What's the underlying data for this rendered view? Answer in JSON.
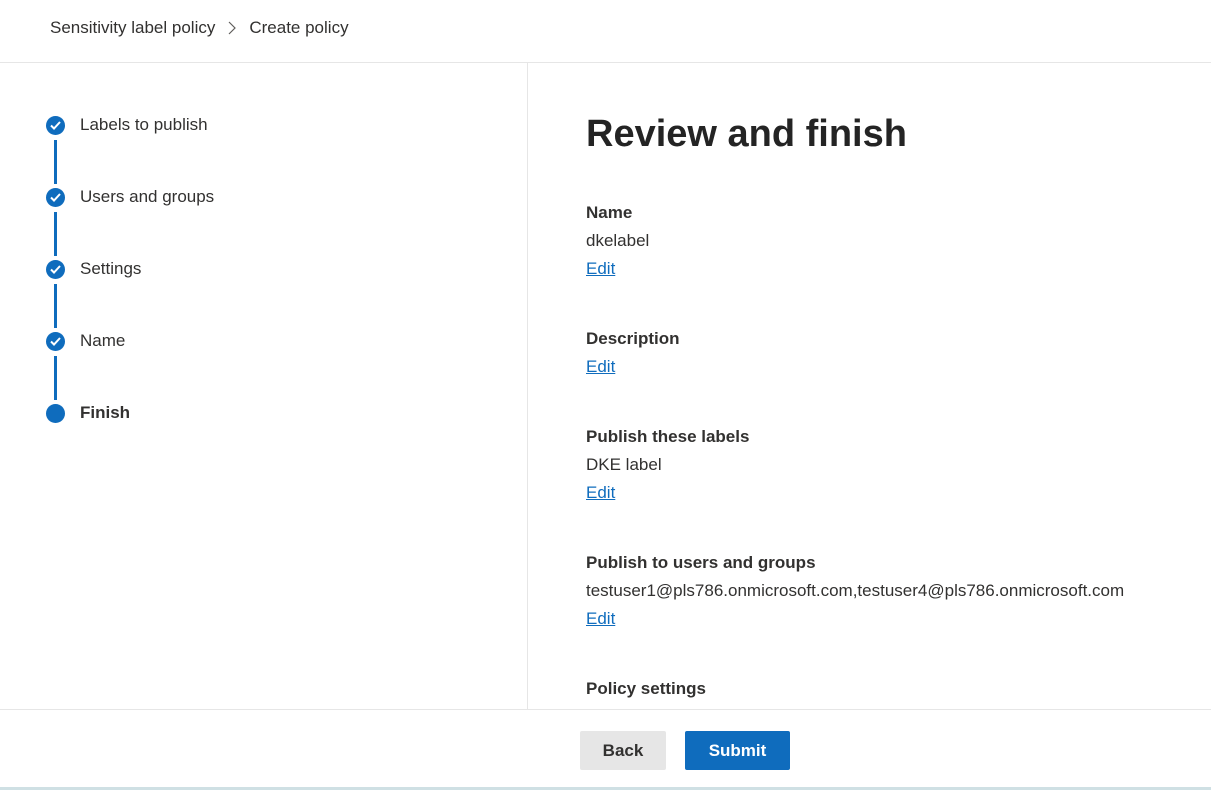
{
  "breadcrumb": {
    "parent": "Sensitivity label policy",
    "current": "Create policy"
  },
  "steps": [
    {
      "label": "Labels to publish",
      "status": "completed"
    },
    {
      "label": "Users and groups",
      "status": "completed"
    },
    {
      "label": "Settings",
      "status": "completed"
    },
    {
      "label": "Name",
      "status": "completed"
    },
    {
      "label": "Finish",
      "status": "current"
    }
  ],
  "main": {
    "title": "Review and finish",
    "sections": [
      {
        "title": "Name",
        "value": "dkelabel",
        "edit": "Edit"
      },
      {
        "title": "Description",
        "value": "",
        "edit": "Edit"
      },
      {
        "title": "Publish these labels",
        "value": "DKE label",
        "edit": "Edit"
      },
      {
        "title": "Publish to users and groups",
        "value": "testuser1@pls786.onmicrosoft.com,testuser4@pls786.onmicrosoft.com",
        "edit": "Edit"
      },
      {
        "title": "Policy settings",
        "value": "",
        "edit": ""
      }
    ]
  },
  "footer": {
    "back_label": "Back",
    "submit_label": "Submit"
  },
  "colors": {
    "accent": "#0f6cbd",
    "text": "#323130",
    "divider": "#e6e6e6"
  },
  "icons": {
    "step_completed": "checkmark-icon",
    "breadcrumb_separator": "chevron-right-icon"
  }
}
